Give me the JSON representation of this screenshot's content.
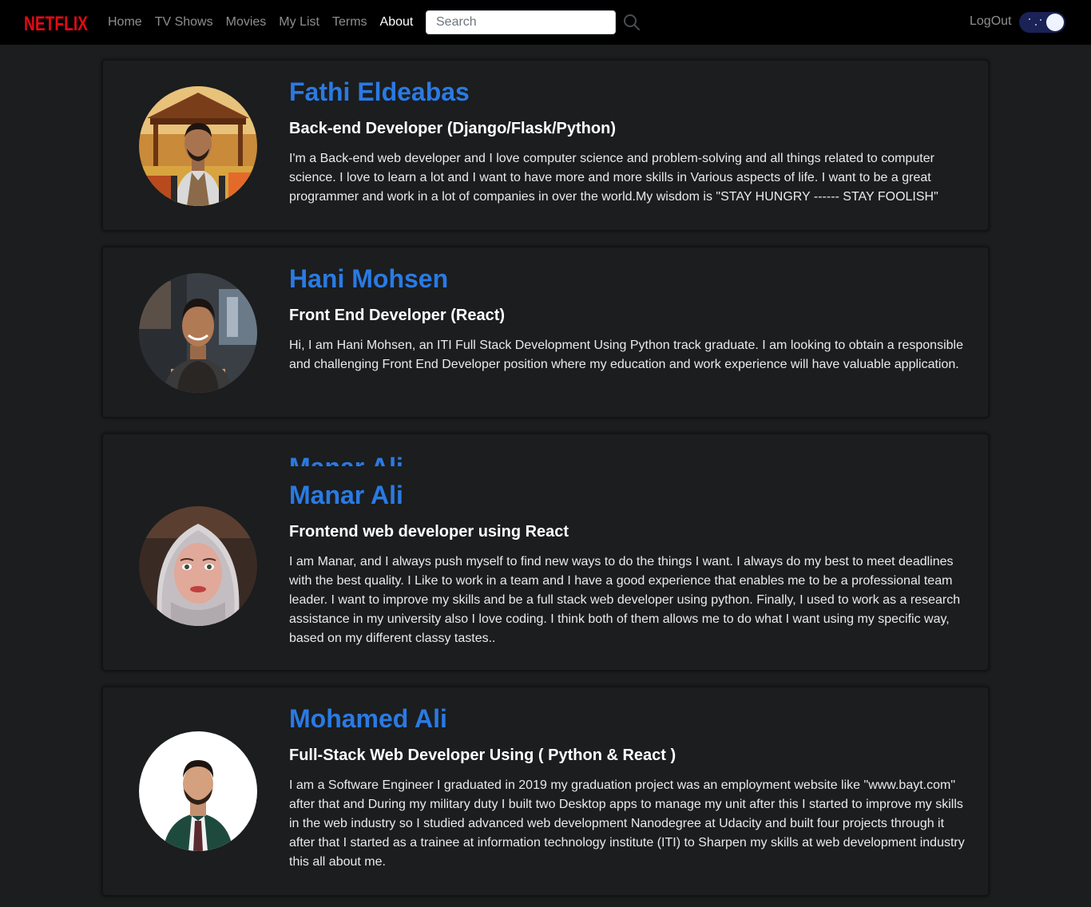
{
  "navbar": {
    "brand": "NETFLIX",
    "links": [
      {
        "label": "Home"
      },
      {
        "label": "TV Shows"
      },
      {
        "label": "Movies"
      },
      {
        "label": "My List"
      },
      {
        "label": "Terms"
      },
      {
        "label": "About",
        "active": true
      }
    ],
    "search_placeholder": "Search",
    "search_icon": "search-icon",
    "logout_label": "LogOut",
    "theme_toggle": "dark-mode-toggle"
  },
  "team": [
    {
      "name": "Fathi Eldeabas",
      "role": "Back-end Developer (Django/Flask/Python)",
      "bio": "I'm a Back-end web developer and I love computer science and problem-solving and all things related to computer science. I love to learn a lot and I want to have more and more skills in Various aspects of life. I want to be a great programmer and work in a lot of companies in over the world.My wisdom is \"STAY HUNGRY ------ STAY FOOLISH\""
    },
    {
      "name": "Hani Mohsen",
      "role": "Front End Developer (React)",
      "bio": "Hi, I am Hani Mohsen, an ITI Full Stack Development Using Python track graduate. I am looking to obtain a responsible and challenging Front End Developer position where my education and work experience will have valuable application."
    },
    {
      "name": "Manar Ali",
      "role": "Frontend web developer using React",
      "bio": "I am Manar, and I always push myself to find new ways to do the things I want. I always do my best to meet deadlines with the best quality. I Like to work in a team and I have a good experience that enables me to be a professional team leader. I want to improve my skills and be a full stack web developer using python. Finally, I used to work as a research assistance in my university also I love coding. I think both of them allows me to do what I want using my specific way, based on my different classy tastes.."
    },
    {
      "name": "Mohamed Ali",
      "role": "Full-Stack Web Developer Using ( Python & React )",
      "bio": "I am a Software Engineer I graduated in 2019 my graduation project was an employment website like \"www.bayt.com\" after that and During my military duty I built two Desktop apps to manage my unit after this I started to improve my skills in the web industry so I studied advanced web development Nanodegree at Udacity and built four projects through it after that I started as a trainee at information technology institute (ITI) to Sharpen my skills at web development industry this all about me."
    }
  ],
  "colors": {
    "background": "#1b1d1e",
    "navbar": "#000000",
    "brand_red": "#e50914",
    "name_blue": "#2a7ae4"
  }
}
